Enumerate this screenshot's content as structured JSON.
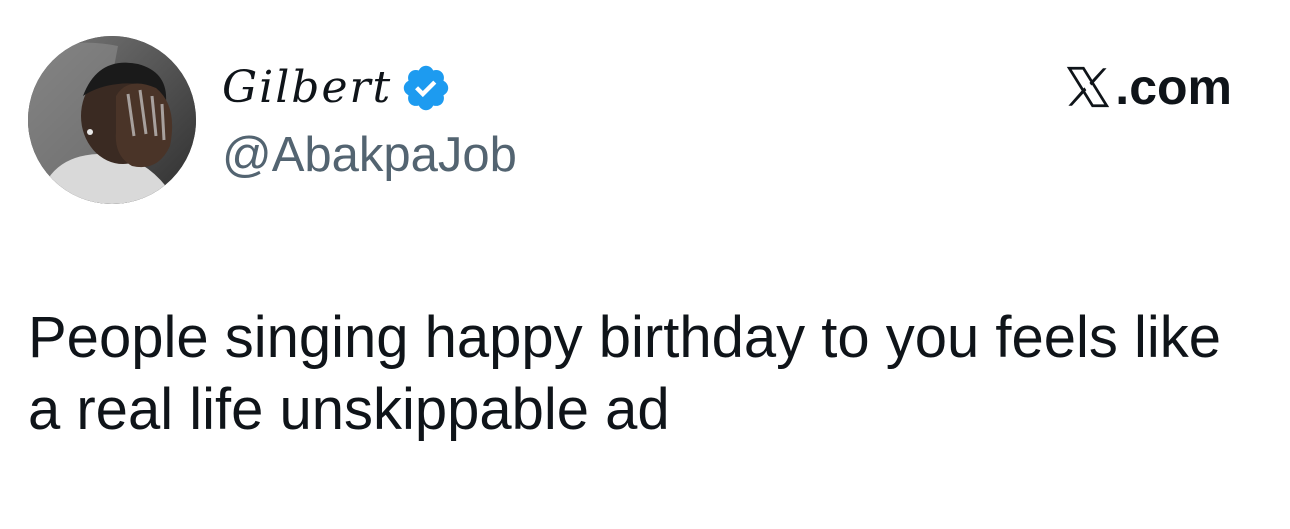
{
  "author": {
    "display_name": "Gilbert",
    "handle": "@AbakpaJob",
    "verified": true,
    "avatar_icon": "profile-photo"
  },
  "brand": {
    "logo_icon": "x-logo-icon",
    "label": ".com"
  },
  "tweet": {
    "text": "People singing happy birthday to you feels like a real life unskippable ad"
  },
  "colors": {
    "text_primary": "#0f1419",
    "text_secondary": "#536471",
    "verified_blue": "#1d9bf0",
    "background": "#ffffff"
  }
}
